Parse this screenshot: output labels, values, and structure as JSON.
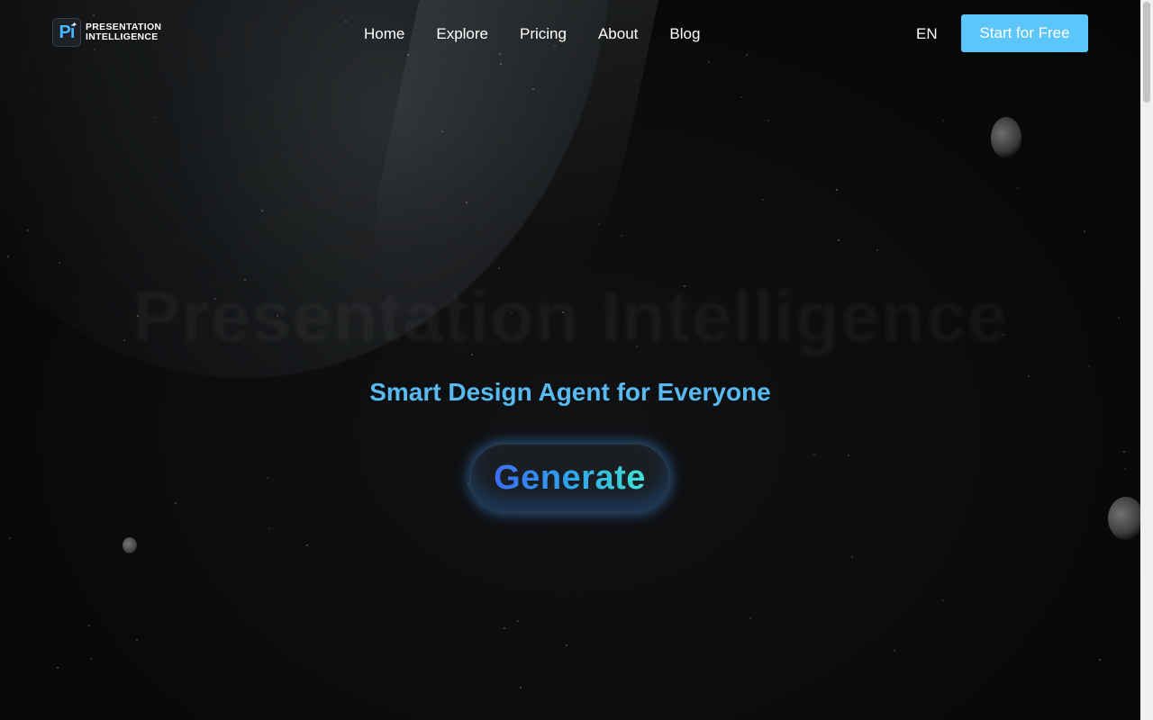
{
  "brand": {
    "mark": "Pi",
    "name_line1": "PRESENTATION",
    "name_line2": "INTELLIGENCE"
  },
  "nav": {
    "items": [
      {
        "label": "Home"
      },
      {
        "label": "Explore"
      },
      {
        "label": "Pricing"
      },
      {
        "label": "About"
      },
      {
        "label": "Blog"
      }
    ],
    "language": "EN",
    "cta_label": "Start for Free"
  },
  "hero": {
    "background_title": "Presentation Intelligence",
    "tagline": "Smart Design Agent for Everyone",
    "generate_label": "Generate"
  },
  "colors": {
    "accent": "#5cc6fb",
    "tagline": "#58baf0",
    "background": "#0a0a0b"
  },
  "icons": {
    "logo": "pi-sparkle-logo-icon"
  }
}
